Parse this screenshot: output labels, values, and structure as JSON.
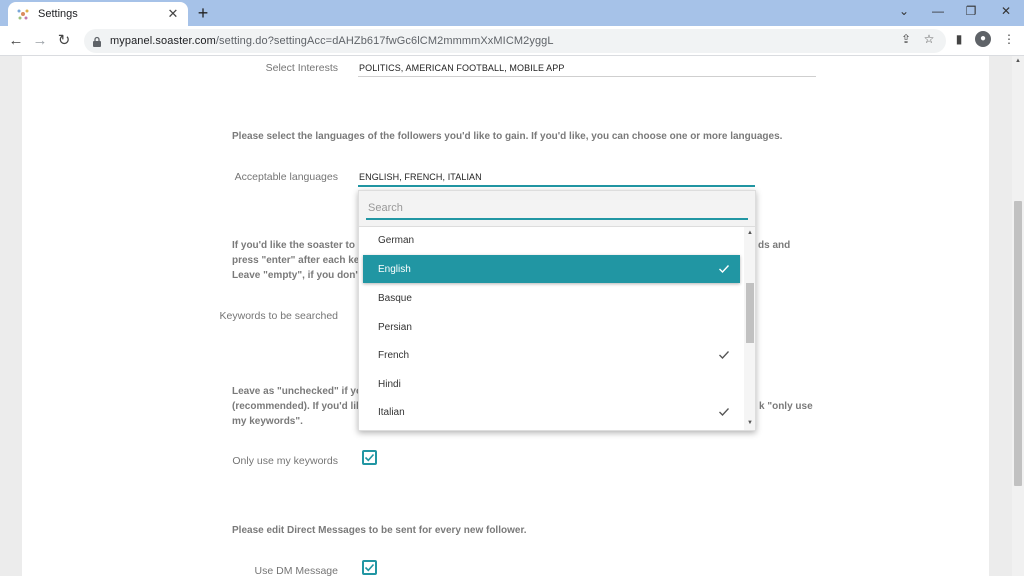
{
  "browser": {
    "tab_title": "Settings",
    "url_host": "mypanel.soaster.com",
    "url_path": "/setting.do?settingAcc=dAHZb617fwGc6lCM2mmmmXxMICM2yggL"
  },
  "form": {
    "interests_label": "Select Interests",
    "interests_value": "POLITICS, AMERICAN FOOTBALL, MOBILE APP",
    "languages_intro": "Please select the languages of the followers you'd like to gain. If you'd like, you can choose one or more languages.",
    "languages_label": "Acceptable languages",
    "languages_value": "ENGLISH, FRENCH, ITALIAN",
    "keywords_para_line1_left": "If you'd like the soaster to u",
    "keywords_para_line1_right": "ds and",
    "keywords_para_line2": "press \"enter\" after each key",
    "keywords_para_line3": "Leave \"empty\", if you don't",
    "keywords_label": "Keywords to be searched",
    "unchecked_para_line1": "Leave as \"unchecked\" if yo",
    "unchecked_para_line2_left": "(recommended). If you'd lik",
    "unchecked_para_line2_right": "k \"only use",
    "unchecked_para_line3": "my keywords\".",
    "only_keywords_label": "Only use my keywords",
    "only_keywords_checked": true,
    "dm_intro": "Please edit Direct Messages to be sent for every new follower.",
    "dm_label": "Use DM Message",
    "dm_checked": true
  },
  "dropdown": {
    "search_placeholder": "Search",
    "options": [
      {
        "label": "German",
        "checked": false,
        "highlighted": false
      },
      {
        "label": "English",
        "checked": true,
        "highlighted": true
      },
      {
        "label": "Basque",
        "checked": false,
        "highlighted": false
      },
      {
        "label": "Persian",
        "checked": false,
        "highlighted": false
      },
      {
        "label": "French",
        "checked": true,
        "highlighted": false
      },
      {
        "label": "Hindi",
        "checked": false,
        "highlighted": false
      },
      {
        "label": "Italian",
        "checked": true,
        "highlighted": false
      }
    ]
  },
  "colors": {
    "accent": "#2196a3"
  }
}
